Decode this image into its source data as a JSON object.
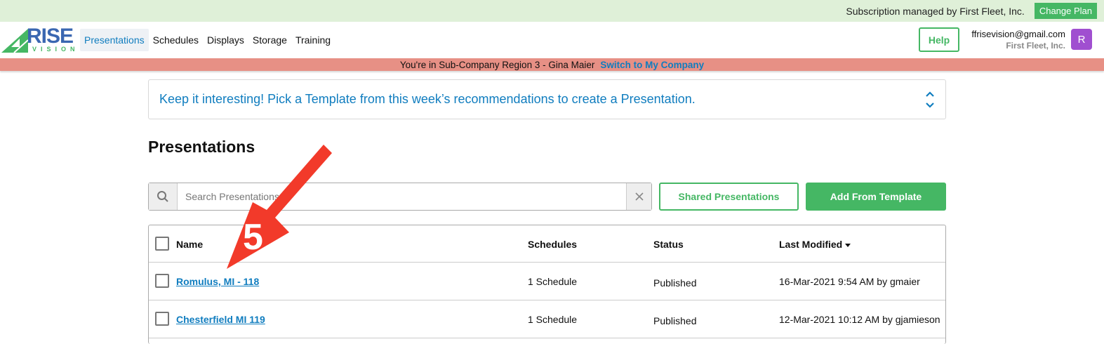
{
  "subscription": {
    "text": "Subscription managed by First Fleet, Inc.",
    "change_plan_label": "Change Plan"
  },
  "logo": {
    "word": "RISE",
    "sub": "VISION"
  },
  "nav": {
    "items": [
      {
        "label": "Presentations",
        "active": true
      },
      {
        "label": "Schedules"
      },
      {
        "label": "Displays"
      },
      {
        "label": "Storage"
      },
      {
        "label": "Training"
      }
    ],
    "help_label": "Help",
    "user_email": "ffrisevision@gmail.com",
    "user_company": "First Fleet, Inc.",
    "avatar_letter": "R"
  },
  "subcompany_banner": {
    "text": "You're in Sub-Company Region 3 - Gina Maier",
    "link": "Switch to My Company"
  },
  "recommendation": {
    "text": "Keep it interesting! Pick a Template from this week’s recommendations to create a Presentation."
  },
  "page_title": "Presentations",
  "search": {
    "placeholder": "Search Presentations"
  },
  "buttons": {
    "shared": "Shared Presentations",
    "add_template": "Add From Template"
  },
  "table": {
    "headers": {
      "name": "Name",
      "schedules": "Schedules",
      "status": "Status",
      "modified": "Last Modified"
    },
    "rows": [
      {
        "name": "Romulus, MI - 118",
        "schedules": "1 Schedule",
        "status": "Published",
        "modified": "16-Mar-2021 9:54 AM by gmaier"
      },
      {
        "name": "Chesterfield MI 119",
        "schedules": "1 Schedule",
        "status": "Published",
        "modified": "12-Mar-2021 10:12 AM by gjamieson"
      }
    ]
  },
  "annotation": {
    "number": "5",
    "color": "#f23a2a"
  },
  "colors": {
    "green": "#45b764",
    "blue": "#107dbf",
    "banner": "#e79085"
  }
}
